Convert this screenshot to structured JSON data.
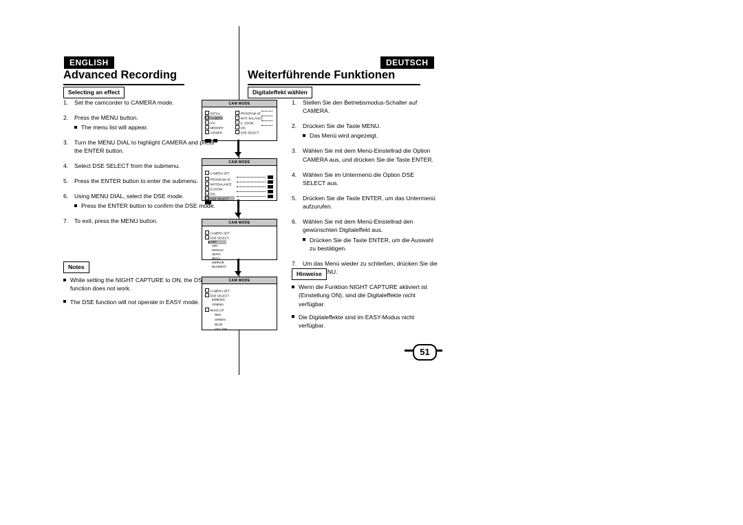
{
  "header": {
    "lang_left": "ENGLISH",
    "lang_right": "DEUTSCH",
    "title_left": "Advanced Recording",
    "title_right": "Weiterführende Funktionen"
  },
  "sections": {
    "left_label": "Selecting an effect",
    "right_label": "Digitaleffekt wählen",
    "notes_left_label": "Notes",
    "notes_right_label": "Hinweise"
  },
  "steps_en": [
    {
      "num": "1.",
      "text": "Set the camcorder to CAMERA mode.",
      "subs": []
    },
    {
      "num": "2.",
      "text": "Press the MENU button.",
      "subs": [
        "The menu list will appear."
      ]
    },
    {
      "num": "3.",
      "text": "Turn the MENU DIAL to highlight CAMERA and press the ENTER button.",
      "subs": []
    },
    {
      "num": "4.",
      "text": "Select DSE SELECT from the submenu.",
      "subs": []
    },
    {
      "num": "5.",
      "text": "Press the ENTER button to enter the submenu.",
      "subs": []
    },
    {
      "num": "6.",
      "text": "Using MENU DIAL, select the DSE mode.",
      "subs": [
        "Press the ENTER button to confirm the DSE mode."
      ]
    },
    {
      "num": "7.",
      "text": "To exit, press the MENU button.",
      "subs": []
    }
  ],
  "steps_de": [
    {
      "num": "1.",
      "text": "Stellen Sie den Betriebsmodus-Schalter auf CAMERA.",
      "subs": []
    },
    {
      "num": "2.",
      "text": "Drücken Sie die Taste MENU.",
      "subs": [
        "Das Menü wird angezeigt."
      ]
    },
    {
      "num": "3.",
      "text": "Wählen Sie mit dem Menü-Einstellrad die Option CAMERA aus, und drücken Sie die Taste ENTER.",
      "subs": []
    },
    {
      "num": "4.",
      "text": "Wählen Sie im Untermenü die Option DSE SELECT aus.",
      "subs": []
    },
    {
      "num": "5.",
      "text": "Drücken Sie die Taste ENTER, um das Untermenü aufzurufen.",
      "subs": []
    },
    {
      "num": "6.",
      "text": "Wählen Sie mit dem Menü-Einstellrad den gewünschten Digitaleffekt aus.",
      "subs": [
        "Drücken Sie die Taste ENTER, um die Auswahl zu bestätigen."
      ]
    },
    {
      "num": "7.",
      "text": "Um das Menü wieder zu schließen, drücken Sie die Taste MENU.",
      "subs": []
    }
  ],
  "notes_en": [
    "While setting the NIGHT CAPTURE to ON, the DSE function does not work.",
    "The DSE function will not operate in EASY mode."
  ],
  "notes_de": [
    "Wenn die Funktion NIGHT CAPTURE aktiviert ist (Einstellung ON), sind die Digitaleffekte nicht verfügbar.",
    "Die Digitaleffekte sind im EASY-Modus nicht verfügbar."
  ],
  "lcd_screens": [
    {
      "title": "CAM MODE",
      "rows": [
        "INITIAL",
        "CAMERA",
        "A/V",
        "MEMORY",
        "VIEWER",
        "PROGRAM AE",
        "WHT. BALANCE",
        "D. ZOOM",
        "DIS",
        "DSE SELECT"
      ]
    },
    {
      "title": "CAM MODE",
      "rows": [
        "CAMERA SET",
        "PROGRAM AE",
        "WHT.BALANCE",
        "D.ZOOM",
        "DIS",
        "DSE SELECT"
      ]
    },
    {
      "title": "CAM MODE",
      "rows": [
        "CAMERA SET",
        "DSE SELECT",
        "OFF",
        "ART",
        "MOSAIC",
        "SEPIA",
        "NEGA",
        "MIRROR",
        "BLK&WHT"
      ]
    },
    {
      "title": "CAM MODE",
      "rows": [
        "CAMERA SET",
        "DSE SELECT",
        "EMBOSS",
        "CINEMA",
        "MAKE-UP",
        "RED",
        "GREEN",
        "BLUE",
        "YELLOW"
      ]
    }
  ],
  "page": {
    "number": "51"
  }
}
